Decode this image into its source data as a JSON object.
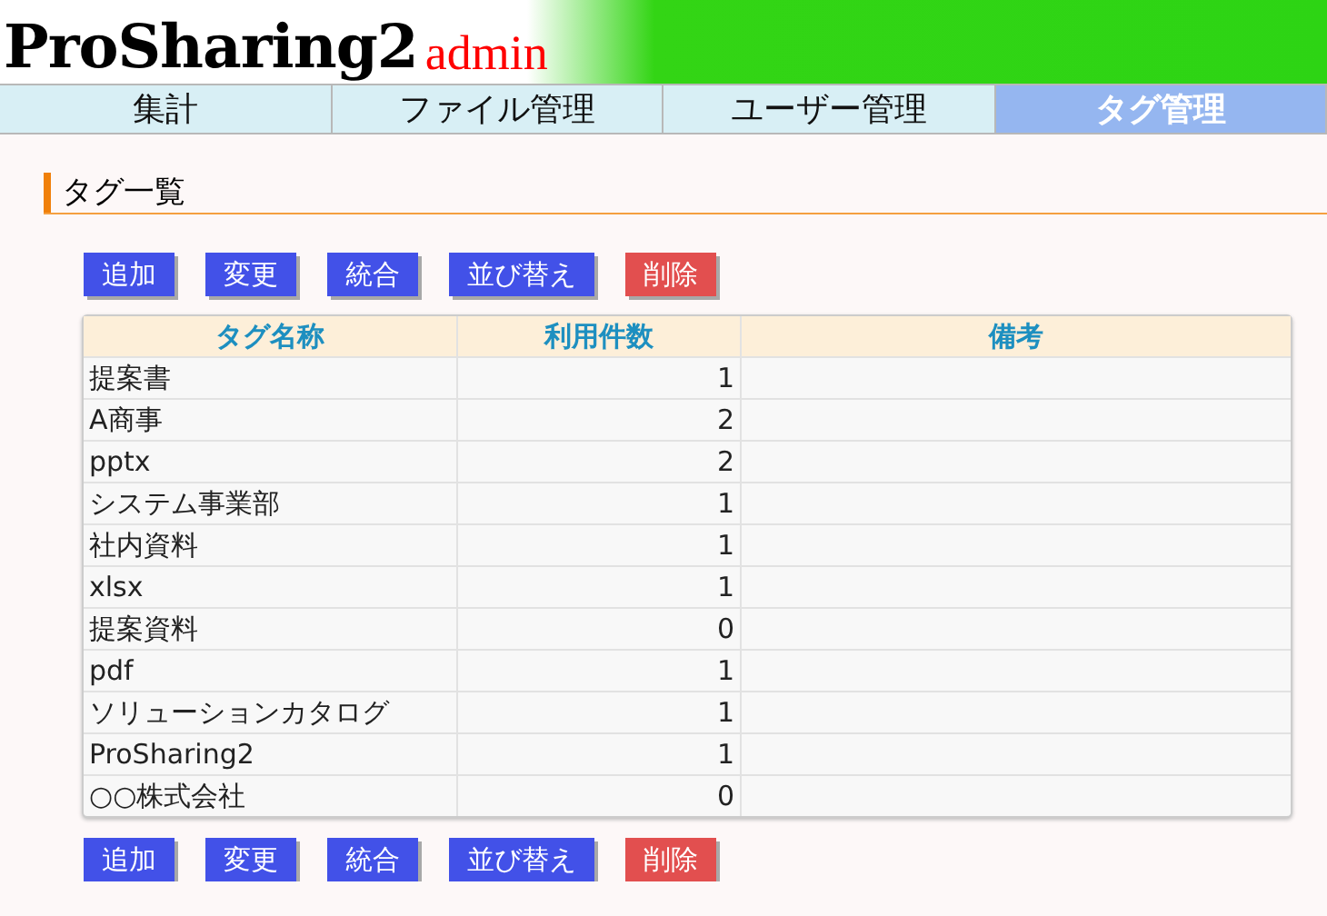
{
  "header": {
    "logo": "ProSharing2",
    "subtitle": "admin"
  },
  "tabs": [
    {
      "label": "集計",
      "selected": false
    },
    {
      "label": "ファイル管理",
      "selected": false
    },
    {
      "label": "ユーザー管理",
      "selected": false
    },
    {
      "label": "タグ管理",
      "selected": true
    }
  ],
  "section_title": "タグ一覧",
  "toolbar_top": [
    {
      "label": "追加",
      "kind": "primary"
    },
    {
      "label": "変更",
      "kind": "primary"
    },
    {
      "label": "統合",
      "kind": "primary"
    },
    {
      "label": "並び替え",
      "kind": "primary"
    },
    {
      "label": "削除",
      "kind": "danger"
    }
  ],
  "table": {
    "columns": [
      "タグ名称",
      "利用件数",
      "備考"
    ],
    "rows": [
      [
        "提案書",
        "1"
      ],
      [
        "A商事",
        "2"
      ],
      [
        "pptx",
        "2"
      ],
      [
        "システム事業部",
        "1"
      ],
      [
        "社内資料",
        "1"
      ],
      [
        "xlsx",
        "1"
      ],
      [
        "提案資料",
        "0"
      ],
      [
        "pdf",
        "1"
      ],
      [
        "ソリューションカタログ",
        "1"
      ],
      [
        "ProSharing2",
        "1"
      ],
      [
        "○○株式会社",
        "0"
      ]
    ]
  },
  "toolbar_bottom": [
    {
      "label": "追加",
      "kind": "primary"
    },
    {
      "label": "変更",
      "kind": "primary"
    },
    {
      "label": "統合",
      "kind": "primary"
    },
    {
      "label": "並び替え",
      "kind": "primary"
    },
    {
      "label": "削除",
      "kind": "danger"
    }
  ]
}
